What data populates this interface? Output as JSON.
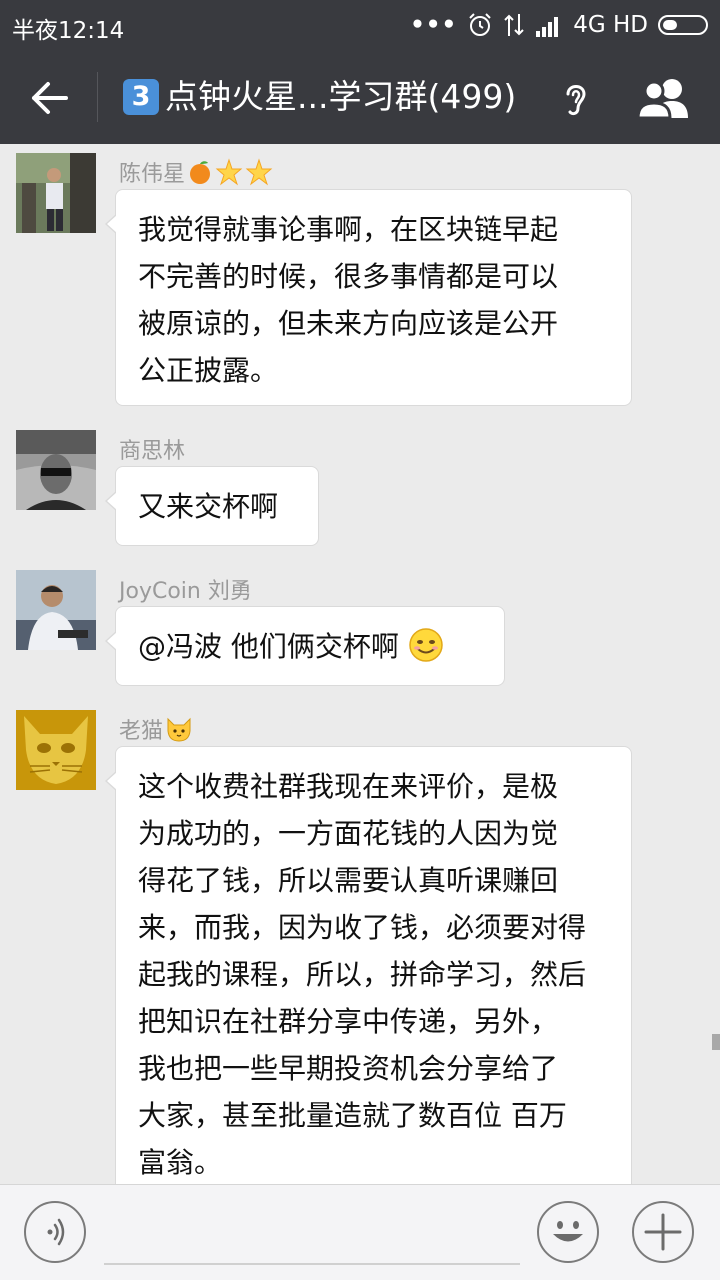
{
  "status": {
    "time": "半夜12:14",
    "network": "4G HD"
  },
  "header": {
    "badge": "3",
    "title": "点钟火星...学习群(499)"
  },
  "messages": [
    {
      "sender": "陈伟星",
      "text": "我觉得就事论事啊，在区块链早起不完善的时候，很多事情都是可以被原谅的，但未来方向应该是公开公正披露。",
      "lines": [
        "我觉得就事论事啊，在区块链早起",
        "不完善的时候，很多事情都是可以",
        "被原谅的，但未来方向应该是公开",
        "公正披露。"
      ]
    },
    {
      "sender": "商思林",
      "text": "又来交杯啊",
      "lines": [
        "又来交杯啊"
      ]
    },
    {
      "sender": "JoyCoin 刘勇",
      "text": "@冯波  他们俩交杯啊",
      "lines": [
        "@冯波  他们俩交杯啊"
      ]
    },
    {
      "sender": "老猫",
      "text": "这个收费社群我现在来评价，是极为成功的，一方面花钱的人因为觉得花了钱，所以需要认真听课赚回来，而我，因为收了钱，必须要对得起我的课程，所以，拼命学习，然后把知识在社群分享中传递，另外，我也把一些早期投资机会分享给了大家，甚至批量造就了数百位 百万富翁。",
      "lines": [
        "这个收费社群我现在来评价，是极",
        "为成功的，一方面花钱的人因为觉",
        "得花了钱，所以需要认真听课赚回",
        "来，而我，因为收了钱，必须要对得",
        "起我的课程，所以，拼命学习，然后",
        "把知识在社群分享中传递，另外，",
        "我也把一些早期投资机会分享给了",
        "大家，甚至批量造就了数百位 百万",
        "富翁。"
      ]
    }
  ],
  "icons": {
    "back": "arrow-left-icon",
    "ear": "ear-icon",
    "members": "group-members-icon",
    "voice": "voice-icon",
    "emoji": "smiley-icon",
    "plus": "plus-icon"
  },
  "colors": {
    "header_bg": "#393a3f",
    "chat_bg": "#ebebeb",
    "bubble_bg": "#ffffff",
    "sender_text": "#9a9a9a"
  }
}
